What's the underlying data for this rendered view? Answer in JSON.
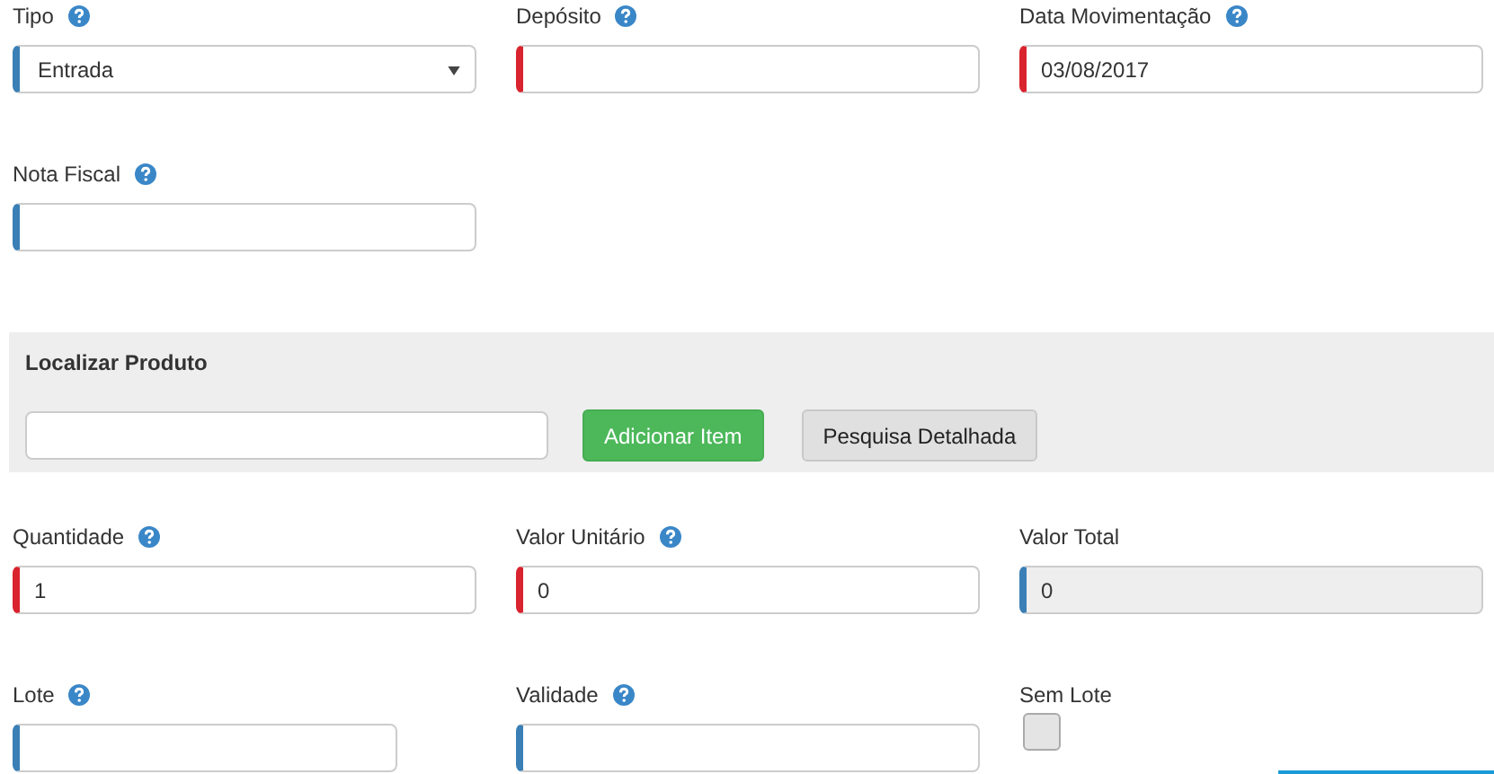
{
  "rows": [
    {
      "fields": [
        {
          "kind": "select",
          "label": "Tipo",
          "help": true,
          "required": false,
          "value": "Entrada",
          "disabled": false
        },
        {
          "kind": "text",
          "label": "Depósito",
          "help": true,
          "required": true,
          "disabled": false
        },
        {
          "kind": "text",
          "label": "Data Movimentação",
          "help": true,
          "required": true,
          "value": "03/08/2017",
          "disabled": false
        }
      ]
    },
    {
      "fields": [
        {
          "kind": "text",
          "label": "Nota Fiscal",
          "help": true,
          "required": false,
          "disabled": false
        }
      ]
    }
  ],
  "product_search": {
    "title": "Localizar Produto",
    "add_button": "Adicionar Item",
    "detail_button": "Pesquisa Detalhada"
  },
  "item_rows": [
    {
      "fields": [
        {
          "kind": "text",
          "label": "Quantidade",
          "help": true,
          "required": true,
          "value": "1",
          "disabled": false
        },
        {
          "kind": "text",
          "label": "Valor Unitário",
          "help": true,
          "required": true,
          "value": "0",
          "disabled": false
        },
        {
          "kind": "text",
          "label": "Valor Total",
          "help": false,
          "required": false,
          "value": "0",
          "disabled": true
        }
      ]
    },
    {
      "fields": [
        {
          "kind": "short",
          "label": "Lote",
          "help": true,
          "required": false,
          "disabled": false
        },
        {
          "kind": "text",
          "label": "Validade",
          "help": true,
          "required": false,
          "disabled": false
        },
        {
          "kind": "checkbox",
          "label": "Sem Lote",
          "help": false,
          "checked": false
        }
      ]
    }
  ]
}
